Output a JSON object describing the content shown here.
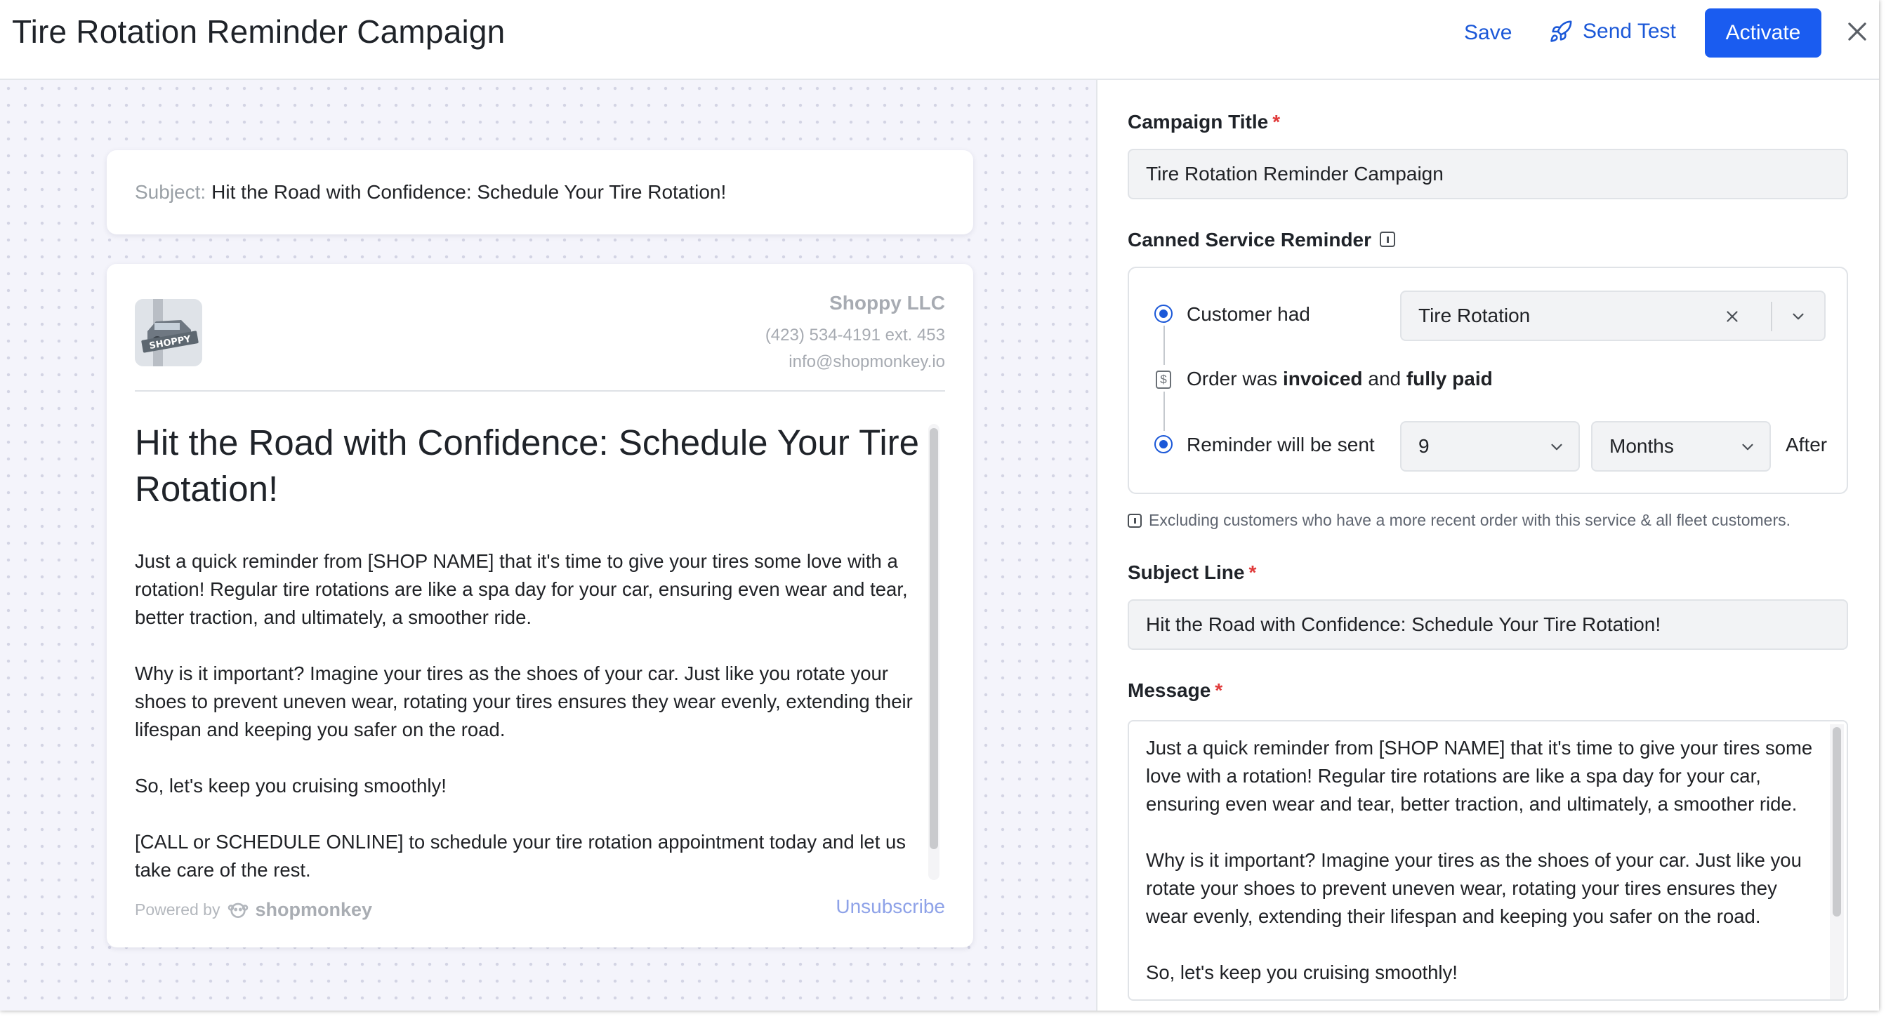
{
  "header": {
    "title": "Tire Rotation Reminder Campaign",
    "save_label": "Save",
    "send_test_label": "Send Test",
    "activate_label": "Activate"
  },
  "preview": {
    "subject_label": "Subject:",
    "subject_value": "Hit the Road with Confidence: Schedule Your Tire Rotation!",
    "shop": {
      "name": "Shoppy LLC",
      "phone": "(423) 534-4191 ext. 453",
      "email": "info@shopmonkey.io",
      "logo_text": "SHOPPY"
    },
    "heading": "Hit the Road with Confidence: Schedule Your Tire Rotation!",
    "paragraphs": [
      "Just a quick reminder from [SHOP NAME] that it's time to give your tires some love with a rotation! Regular tire rotations are like a spa day for your car, ensuring even wear and tear, better traction, and ultimately, a smoother ride.",
      "Why is it important? Imagine your tires as the shoes of your car. Just like you rotate your shoes to prevent uneven wear, rotating your tires ensures they wear evenly, extending their lifespan and keeping you safer on the road.",
      "So, let's keep you cruising smoothly!",
      "[CALL or SCHEDULE ONLINE] to schedule your tire rotation appointment today and let us take care of the rest."
    ],
    "powered_by": "Powered by",
    "powered_brand": "shopmonkey",
    "unsubscribe": "Unsubscribe"
  },
  "form": {
    "campaign_title_label": "Campaign Title",
    "campaign_title_value": "Tire Rotation Reminder Campaign",
    "canned_label": "Canned Service Reminder",
    "customer_had": "Customer had",
    "service_value": "Tire Rotation",
    "order_prefix": "Order was",
    "order_invoiced": "invoiced",
    "order_and": "and",
    "order_paid": "fully paid",
    "reminder_label": "Reminder will be sent",
    "reminder_count": "9",
    "reminder_unit": "Months",
    "reminder_after": "After",
    "note": "Excluding customers who have a more recent order with this service & all fleet customers.",
    "subject_label": "Subject Line",
    "subject_value": "Hit the Road with Confidence: Schedule Your Tire Rotation!",
    "message_label": "Message",
    "required_mark": "*",
    "message_paragraphs": [
      "Just a quick reminder from [SHOP NAME] that it's time to give your tires some love with a rotation! Regular tire rotations are like a spa day for your car, ensuring even wear and tear, better traction, and ultimately, a smoother ride.",
      "Why is it important? Imagine your tires as the shoes of your car. Just like you rotate your shoes to prevent uneven wear, rotating your tires ensures they wear evenly, extending their lifespan and keeping you safer on the road.",
      "So, let's keep you cruising smoothly!"
    ]
  },
  "colors": {
    "accent": "#1a5cf0",
    "link": "#1b58d8",
    "required": "#e03a3a"
  },
  "icons": {
    "send_test": "rocket-icon",
    "close": "close-icon",
    "info": "info-icon",
    "clear": "clear-x-icon",
    "dropdown": "chevron-down-icon",
    "invoice": "dollar-icon"
  }
}
